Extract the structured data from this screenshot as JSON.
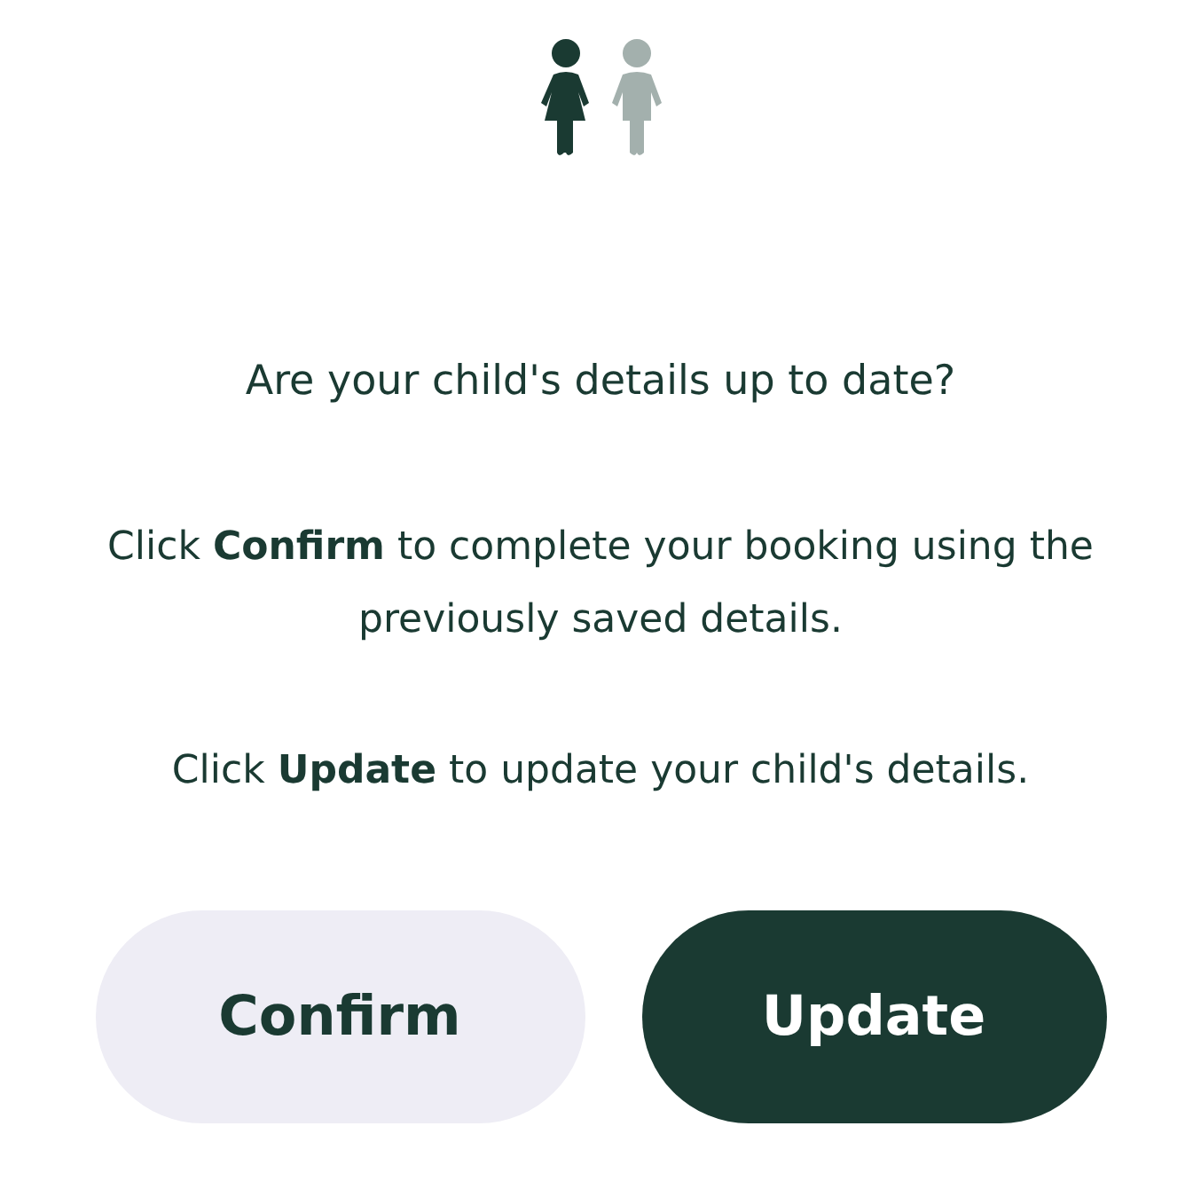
{
  "question": "Are your child's details up to date?",
  "paragraphs": [
    "Click **Confirm** to complete your booking using the previously saved details.",
    "Click **Update** to update your child's details."
  ],
  "buttons": [
    {
      "label": "Confirm",
      "kind": "secondary"
    },
    {
      "label": "Update",
      "kind": "primary"
    }
  ]
}
